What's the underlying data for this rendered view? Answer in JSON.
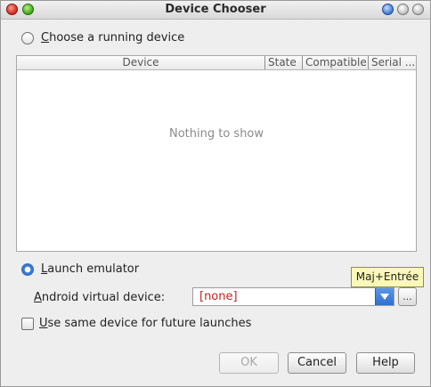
{
  "window": {
    "title": "Device Chooser"
  },
  "choose_running": {
    "label_first": "C",
    "label_rest": "hoose a running device",
    "selected": false
  },
  "device_table": {
    "columns": [
      "Device",
      "State",
      "Compatible",
      "Serial ..."
    ],
    "empty_text": "Nothing to show"
  },
  "launch_emulator": {
    "label_first": "L",
    "label_rest": "aunch emulator",
    "selected": true
  },
  "avd": {
    "label_first": "A",
    "label_rest": "ndroid virtual device:",
    "selected_value": "[none]",
    "browse_label": "..."
  },
  "tooltip": {
    "text": "Maj+Entrée"
  },
  "same_device": {
    "label_first": "U",
    "label_rest": "se same device for future launches",
    "checked": false
  },
  "buttons": {
    "ok": "OK",
    "cancel": "Cancel",
    "help": "Help"
  },
  "colors": {
    "accent": "#3d7fdc",
    "value_red": "#c0241c",
    "tooltip_bg": "#fbf7b8"
  }
}
